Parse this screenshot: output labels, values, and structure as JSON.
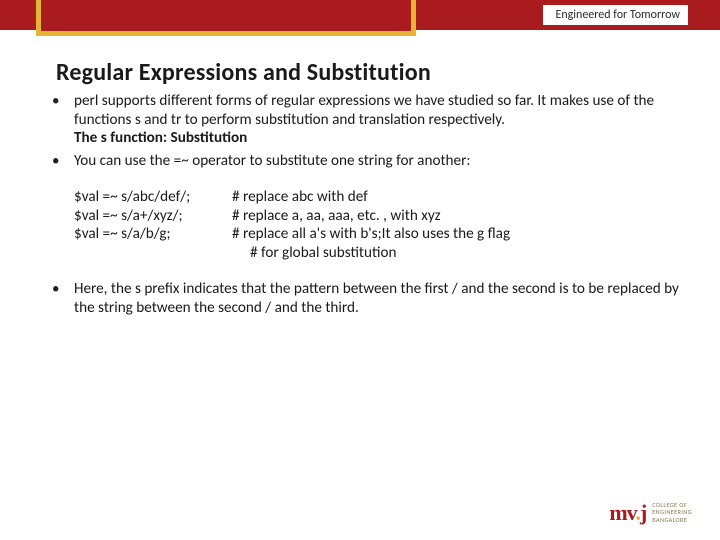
{
  "header": {
    "tagline": "Engineered for Tomorrow"
  },
  "title": "Regular Expressions and Substitution",
  "bullets": {
    "b1_line1": "perl supports different forms of regular expressions we have studied so far. It makes use of the functions s and tr to perform substitution and translation respectively.",
    "b1_line2": "The s function: Substitution",
    "b2": "You can use the =~ operator to substitute one string for another:",
    "b3": "Here, the s prefix indicates that the pattern between the first / and the second is to be replaced by the string between the second / and the third."
  },
  "code": {
    "r1_left": "$val =~ s/abc/def/;",
    "r1_right": "# replace abc with def",
    "r2_left": "$val =~ s/a+/xyz/;",
    "r2_right": "# replace a, aa, aaa, etc. , with xyz",
    "r3_left": "$val =~ s/a/b/g;",
    "r3_right": "# replace all a's with b's;It also uses the g flag",
    "r3_cont": "# for global   substitution"
  },
  "logo": {
    "mark_m": "m",
    "mark_v": "v",
    "mark_j": "j",
    "t1": "COLLEGE OF",
    "t2": "ENGINEERING",
    "t3": "BANGALORE"
  }
}
